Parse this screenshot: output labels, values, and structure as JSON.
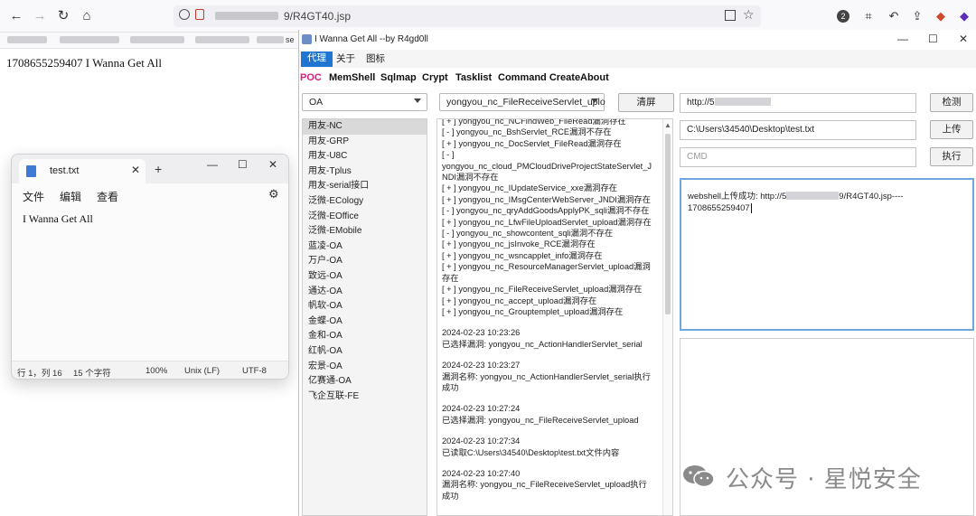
{
  "browser": {
    "back": "←",
    "forward": "→",
    "reload": "↻",
    "home": "⌂",
    "url_suffix": "9/R4GT40.jsp",
    "page_text": "1708655259407 I Wanna Get All",
    "bookmark_fragment": "se"
  },
  "notepad": {
    "tab_title": "test.txt",
    "tab_close": "✕",
    "new_tab": "+",
    "menus": [
      "文件",
      "编辑",
      "查看"
    ],
    "content": "I Wanna Get All",
    "status": {
      "position": "行 1，列 16",
      "chars": "15 个字符",
      "zoom": "100%",
      "line_ending": "Unix (LF)",
      "encoding": "UTF-8"
    }
  },
  "tool": {
    "title": "I Wanna Get All    --by R4gd0ll",
    "menus": [
      "代理",
      "关于",
      "图标"
    ],
    "tabs": [
      "POC",
      "MemShell",
      "Sqlmap",
      "Crypt",
      "Tasklist",
      "Command Create",
      "About"
    ],
    "category_select": "OA",
    "vuln_select": "yongyou_nc_FileReceiveServlet_uplo",
    "clear_button": "清屏",
    "url_prefix": "http://5",
    "check_button": "检测",
    "upload_path": "C:\\Users\\34540\\Desktop\\test.txt",
    "upload_button": "上传",
    "cmd_placeholder": "CMD",
    "exec_button": "执行",
    "result_prefix": "webshell上传成功: http://5",
    "result_suffix": "9/R4GT40.jsp----",
    "result_id": "1708655259407",
    "targets": [
      "用友-NC",
      "用友-GRP",
      "用友-U8C",
      "用友-Tplus",
      "用友-serial接口",
      "泛微-ECology",
      "泛微-EOffice",
      "泛微-EMobile",
      "蓝凌-OA",
      "万户-OA",
      "致远-OA",
      "通达-OA",
      "帆软-OA",
      "金蝶-OA",
      "金和-OA",
      "红帆-OA",
      "宏景-OA",
      "亿赛通-OA",
      "飞企互联-FE"
    ],
    "log": [
      "[ + ] yongyou_nc_NCFindWeb_FileRead漏洞存在",
      "[ - ] yongyou_nc_BshServlet_RCE漏洞不存在",
      "[ + ] yongyou_nc_DocServlet_FileRead漏洞存在",
      "[ - ]",
      "yongyou_nc_cloud_PMCloudDriveProjectStateServlet_J",
      "NDI漏洞不存在",
      "[ + ] yongyou_nc_IUpdateService_xxe漏洞存在",
      "[ + ] yongyou_nc_IMsgCenterWebServer_JNDI漏洞存在",
      "[ - ] yongyou_nc_qryAddGoodsApplyPK_sqli漏洞不存在",
      "[ + ] yongyou_nc_LfwFileUploadServlet_upload漏洞存在",
      "[ - ] yongyou_nc_showcontent_sqli漏洞不存在",
      "[ + ] yongyou_nc_jsInvoke_RCE漏洞存在",
      "[ + ] yongyou_nc_wsncapplet_info漏洞存在",
      "[ + ] yongyou_nc_ResourceManagerServlet_upload漏洞",
      "存在",
      "[ + ] yongyou_nc_FileReceiveServlet_upload漏洞存在",
      "[ + ] yongyou_nc_accept_upload漏洞存在",
      "[ + ] yongyou_nc_Grouptemplet_upload漏洞存在",
      "",
      "2024-02-23 10:23:26",
      "已选择漏洞: yongyou_nc_ActionHandlerServlet_serial",
      "",
      "2024-02-23 10:23:27",
      "漏洞名称: yongyou_nc_ActionHandlerServlet_serial执行",
      "成功",
      "",
      "2024-02-23 10:27:24",
      "已选择漏洞: yongyou_nc_FileReceiveServlet_upload",
      "",
      "2024-02-23 10:27:34",
      "已读取C:\\Users\\34540\\Desktop\\test.txt文件内容",
      "",
      "2024-02-23 10:27:40",
      "漏洞名称: yongyou_nc_FileReceiveServlet_upload执行",
      "成功"
    ]
  },
  "watermark": "公众号 · 星悦安全",
  "colors": {
    "menu_active": "#1f76d2",
    "tab_active": "#d6217f",
    "result_border": "#6ea7dd"
  }
}
